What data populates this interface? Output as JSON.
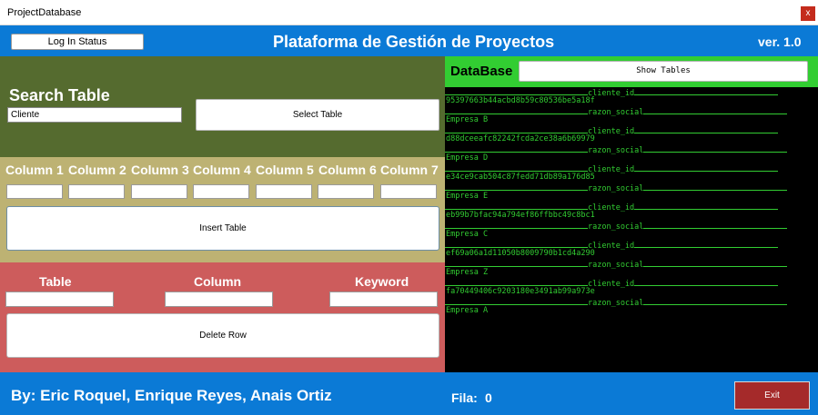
{
  "window": {
    "title": "ProjectDatabase",
    "close_label": "x"
  },
  "header": {
    "login_label": "Log In Status",
    "title": "Plataforma de Gestión de Proyectos",
    "version": "ver. 1.0"
  },
  "search": {
    "title": "Search Table",
    "input_value": "Cliente",
    "select_label": "Select Table"
  },
  "insert": {
    "columns": [
      "Column 1",
      "Column 2",
      "Column 3",
      "Column 4",
      "Column 5",
      "Column 6",
      "Column 7"
    ],
    "insert_label": "Insert Table"
  },
  "delete": {
    "table_label": "Table",
    "column_label": "Column",
    "keyword_label": "Keyword",
    "delete_label": "Delete Row"
  },
  "database": {
    "title": "DataBase",
    "show_label": "Show Tables",
    "console": [
      {
        "field": "cliente_id",
        "value": "95397663b44acbd8b59c80536be5a18f"
      },
      {
        "field": "razon_social",
        "value": "Empresa B"
      },
      {
        "field": "cliente_id",
        "value": "d88dceeafc82242fcda2ce38a6b69979"
      },
      {
        "field": "razon_social",
        "value": "Empresa D"
      },
      {
        "field": "cliente_id",
        "value": "e34ce9cab504c87fedd71db89a176d85"
      },
      {
        "field": "razon_social",
        "value": "Empresa E"
      },
      {
        "field": "cliente_id",
        "value": "eb99b7bfac94a794ef86ffbbc49c8bc1"
      },
      {
        "field": "razon_social",
        "value": "Empresa C"
      },
      {
        "field": "cliente_id",
        "value": "ef69a06a1d11050b8009790b1cd4a290"
      },
      {
        "field": "razon_social",
        "value": "Empresa Z"
      },
      {
        "field": "cliente_id",
        "value": "fa70449406c9203180e3491ab99a973e"
      },
      {
        "field": "razon_social",
        "value": "Empresa A"
      }
    ]
  },
  "footer": {
    "authors": "By: Eric Roquel, Enrique Reyes, Anais Ortiz",
    "fila_label": "Fila:",
    "fila_value": "0",
    "exit_label": "Exit"
  }
}
